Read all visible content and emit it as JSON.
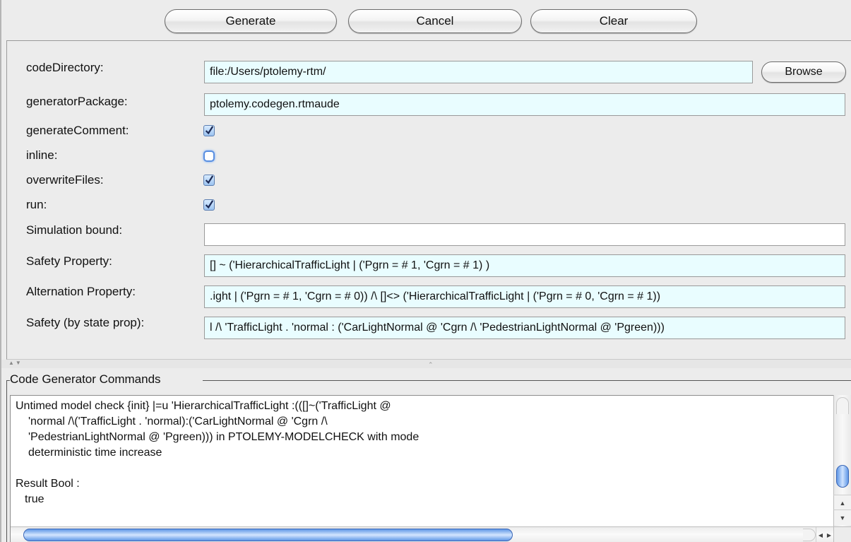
{
  "toolbar": {
    "generate_label": "Generate",
    "cancel_label": "Cancel",
    "clear_label": "Clear"
  },
  "parameters": {
    "codeDirectory": {
      "label": "codeDirectory:",
      "value": "file:/Users/ptolemy-rtm/"
    },
    "browse_label": "Browse",
    "generatorPackage": {
      "label": "generatorPackage:",
      "value": "ptolemy.codegen.rtmaude"
    },
    "generateComment": {
      "label": "generateComment:",
      "checked": true
    },
    "inline": {
      "label": "inline:",
      "checked": false
    },
    "overwriteFiles": {
      "label": "overwriteFiles:",
      "checked": true
    },
    "run": {
      "label": "run:",
      "checked": true
    },
    "simulationBound": {
      "label": "Simulation bound:",
      "value": ""
    },
    "safetyProperty": {
      "label": "Safety Property:",
      "value": "[] ~ ('HierarchicalTrafficLight | ('Pgrn = # 1, 'Cgrn = # 1) )"
    },
    "alternationProperty": {
      "label": "Alternation Property:",
      "value": ".ight | ('Pgrn = # 1, 'Cgrn = # 0)) /\\ []<> ('HierarchicalTrafficLight | ('Pgrn = # 0, 'Cgrn = # 1))"
    },
    "safetyStateProp": {
      "label": "Safety (by state prop):",
      "value": "l /\\  'TrafficLight . 'normal : ('CarLightNormal @ 'Cgrn /\\  'PedestrianLightNormal @ 'Pgreen)))"
    }
  },
  "commands": {
    "title": "Code Generator Commands",
    "lines": [
      "Untimed model check {init}  |=u 'HierarchicalTrafficLight :(([]~('TrafficLight @",
      "'normal /\\('TrafficLight . 'normal):('CarLightNormal @ 'Cgrn /\\",
      "'PedestrianLightNormal @ 'Pgreen))) in PTOLEMY-MODELCHECK with mode",
      "deterministic time increase",
      "",
      "Result Bool :",
      "true"
    ]
  },
  "icons": {
    "checkbox_checked": "checkmark-icon",
    "checkbox_unchecked": "empty-checkbox-icon",
    "scroll_up": "arrow-up-icon",
    "scroll_down": "arrow-down-icon",
    "scroll_left": "arrow-left-icon",
    "scroll_right": "arrow-right-icon",
    "divider_expand": "split-arrows-icon"
  },
  "colors": {
    "field_bg": "#e9fdff",
    "window_bg": "#ececec",
    "scroll_thumb": "#5f97e6"
  }
}
